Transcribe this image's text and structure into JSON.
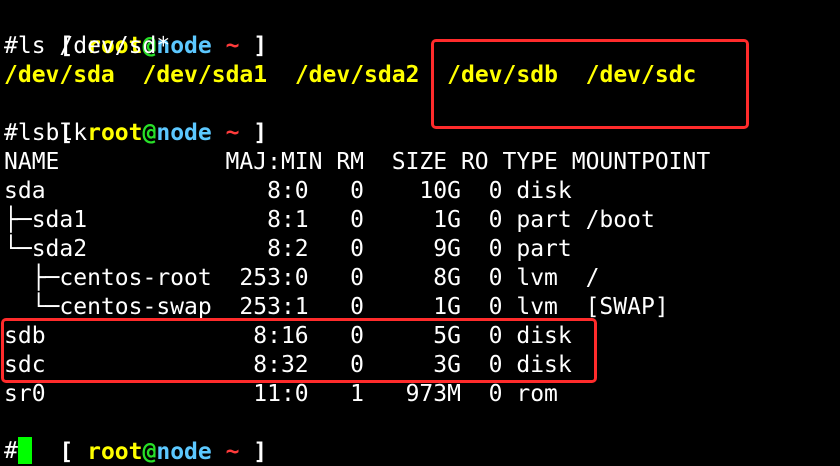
{
  "prompt": {
    "open": "[ ",
    "user": "root",
    "at": "@",
    "host": "node",
    "tilde": " ~ ",
    "close": "]",
    "symbol": "#"
  },
  "commands": {
    "ls": "#ls /dev/sd*",
    "lsblk": "#lsblk"
  },
  "ls_output": [
    "/dev/sda",
    "/dev/sda1",
    "/dev/sda2",
    "/dev/sdb",
    "/dev/sdc"
  ],
  "lsblk": {
    "headers": [
      "NAME",
      "MAJ:MIN",
      "RM",
      "SIZE",
      "RO",
      "TYPE",
      "MOUNTPOINT"
    ],
    "rows": [
      {
        "prefix": "",
        "name": "sda",
        "majmin": "8:0",
        "rm": "0",
        "size": "10G",
        "ro": "0",
        "type": "disk",
        "mount": ""
      },
      {
        "prefix": "├─",
        "name": "sda1",
        "majmin": "8:1",
        "rm": "0",
        "size": "1G",
        "ro": "0",
        "type": "part",
        "mount": "/boot"
      },
      {
        "prefix": "└─",
        "name": "sda2",
        "majmin": "8:2",
        "rm": "0",
        "size": "9G",
        "ro": "0",
        "type": "part",
        "mount": ""
      },
      {
        "prefix": "  ├─",
        "name": "centos-root",
        "majmin": "253:0",
        "rm": "0",
        "size": "8G",
        "ro": "0",
        "type": "lvm",
        "mount": "/"
      },
      {
        "prefix": "  └─",
        "name": "centos-swap",
        "majmin": "253:1",
        "rm": "0",
        "size": "1G",
        "ro": "0",
        "type": "lvm",
        "mount": "[SWAP]"
      },
      {
        "prefix": "",
        "name": "sdb",
        "majmin": "8:16",
        "rm": "0",
        "size": "5G",
        "ro": "0",
        "type": "disk",
        "mount": ""
      },
      {
        "prefix": "",
        "name": "sdc",
        "majmin": "8:32",
        "rm": "0",
        "size": "3G",
        "ro": "0",
        "type": "disk",
        "mount": ""
      },
      {
        "prefix": "",
        "name": "sr0",
        "majmin": "11:0",
        "rm": "1",
        "size": "973M",
        "ro": "0",
        "type": "rom",
        "mount": ""
      }
    ]
  },
  "colors": {
    "background": "#000000",
    "text": "#ffffff",
    "user": "#ffff00",
    "at": "#28e028",
    "host": "#5cc8ff",
    "tilde": "#ff3b3b",
    "ls_output": "#ffff00",
    "cursor": "#00ff00",
    "highlight_box": "#ff2b2b"
  }
}
